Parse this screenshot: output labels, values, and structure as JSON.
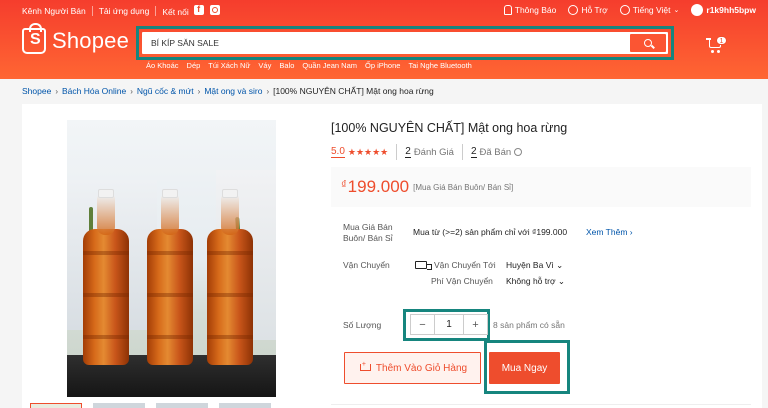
{
  "topbar": {
    "left_items": [
      "Kênh Người Bán",
      "Tải ứng dụng",
      "Kết nối"
    ],
    "notifications": "Thông Báo",
    "help": "Hỗ Trợ",
    "language": "Tiếng Việt",
    "username": "r1k9hh5bpw"
  },
  "logo": {
    "text": "Shopee"
  },
  "search": {
    "value": "BÍ KÍP SĂN SALE"
  },
  "suggestions": [
    "Áo Khoác",
    "Dép",
    "Túi Xách Nữ",
    "Váy",
    "Balo",
    "Quần Jean Nam",
    "Ốp iPhone",
    "Tai Nghe Bluetooth"
  ],
  "cart": {
    "count": "1"
  },
  "breadcrumb": {
    "items": [
      "Shopee",
      "Bách Hóa Online",
      "Ngũ cốc & mứt",
      "Mật ong và siro"
    ],
    "current": "[100% NGUYÊN CHẤT] Mật ong hoa rừng"
  },
  "product": {
    "title": "[100% NGUYÊN CHẤT] Mật ong hoa rừng",
    "rating": "5.0",
    "stars": "★★★★★",
    "rating_count": "2",
    "rating_label": "Đánh Giá",
    "sold_count": "2",
    "sold_label": "Đã Bán",
    "price_currency": "₫",
    "price": "199.000",
    "price_note": "[Mua Giá Bán Buôn/ Bán Sỉ]",
    "wholesale_label": "Mua Giá Bán Buôn/ Bán Sỉ",
    "wholesale_text": "Mua từ (>=2) sản phẩm chỉ với ₫199.000",
    "see_more": "Xem Thêm",
    "shipping_label": "Vận Chuyển",
    "ship_to_label": "Vận Chuyển Tới",
    "ship_to_value": "Huyện Ba Vì",
    "ship_fee_label": "Phí Vận Chuyển",
    "ship_fee_value": "Không hỗ trợ",
    "quantity_label": "Số Lượng",
    "quantity": "1",
    "stock": "8 sản phẩm có sẵn",
    "add_to_cart": "Thêm Vào Giỏ Hàng",
    "buy_now": "Mua Ngay"
  },
  "colors": {
    "brand": "#ee4d2d",
    "highlight": "#16857e",
    "link": "#0055aa"
  }
}
